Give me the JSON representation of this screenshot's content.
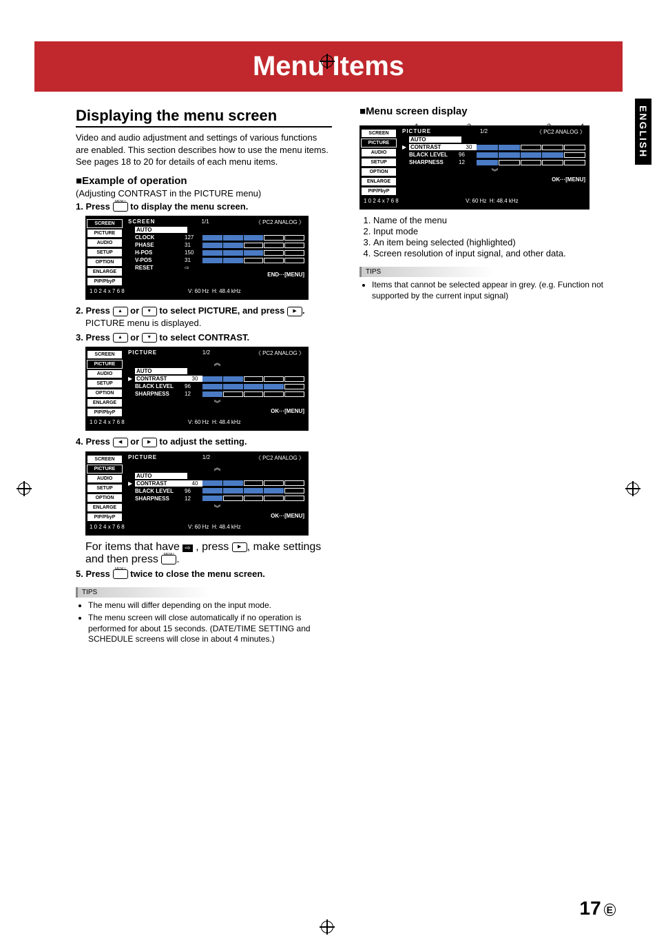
{
  "banner": "Menu Items",
  "lang_tab": "ENGLISH",
  "page_number": "17",
  "page_letter": "E",
  "left": {
    "h2": "Displaying the menu screen",
    "intro": "Video and audio adjustment and settings of various functions are enabled. This section describes how to use the menu items. See pages 18 to 20 for details of each menu items.",
    "h3": "Example of operation",
    "h3_sub": "(Adjusting CONTRAST in the PICTURE menu)",
    "steps": {
      "s1": "Press        to display the menu screen.",
      "s2": "Press        or        to select PICTURE, and press       .",
      "s2_after": "PICTURE menu is displayed.",
      "s3": "Press        or        to select CONTRAST.",
      "s4": "Press        or        to adjust the setting.",
      "s4_after1": "For items that have      , press       , make settings and then press       .",
      "s5": "Press        twice to close the menu screen."
    },
    "tips_label": "TIPS",
    "tips": [
      "The menu will differ depending on the input mode.",
      "The menu screen will close automatically if no operation is performed for about 15 seconds. (DATE/TIME SETTING and SCHEDULE screens will close in about 4 minutes.)"
    ]
  },
  "right": {
    "h3": "Menu screen display",
    "legend": [
      "Name of the menu",
      "Input mode",
      "An item being selected (highlighted)",
      "Screen resolution of input signal, and other data."
    ],
    "tips_label": "TIPS",
    "tips": [
      "Items that cannot be selected appear in grey. (e.g. Function not supported by the current input signal)"
    ]
  },
  "osd": {
    "tabs": [
      "SCREEN",
      "PICTURE",
      "AUDIO",
      "SETUP",
      "OPTION",
      "ENLARGE",
      "PIP/PbyP"
    ],
    "screen1": {
      "title": "SCREEN",
      "page": "1/1",
      "input": "〈 PC2 ANALOG 〉",
      "rows": [
        {
          "n": "AUTO",
          "hl": true
        },
        {
          "n": "CLOCK",
          "v": "127",
          "bar": 3
        },
        {
          "n": "PHASE",
          "v": "31",
          "bar": 2
        },
        {
          "n": "H-POS",
          "v": "150",
          "bar": 3
        },
        {
          "n": "V-POS",
          "v": "31",
          "bar": 2
        },
        {
          "n": "RESET",
          "v": "⇨"
        }
      ],
      "end": "END···[MENU]"
    },
    "screen2": {
      "title": "PICTURE",
      "page": "1/2",
      "input": "〈 PC2 ANALOG 〉",
      "rows": [
        {
          "n": "AUTO",
          "hl": true
        },
        {
          "n": "CONTRAST",
          "sel": true,
          "v": "30",
          "box": true,
          "bar": 2
        },
        {
          "n": "BLACK LEVEL",
          "v": "96",
          "bar": 4
        },
        {
          "n": "SHARPNESS",
          "v": "12",
          "bar": 1
        }
      ],
      "end": "OK···[MENU]"
    },
    "screen3": {
      "title": "PICTURE",
      "page": "1/2",
      "input": "〈 PC2 ANALOG 〉",
      "rows": [
        {
          "n": "AUTO",
          "hl": true
        },
        {
          "n": "CONTRAST",
          "sel": true,
          "v": "40",
          "box": true,
          "bar": 2
        },
        {
          "n": "BLACK LEVEL",
          "v": "96",
          "bar": 4
        },
        {
          "n": "SHARPNESS",
          "v": "12",
          "bar": 1
        }
      ],
      "end": "OK···[MENU]"
    },
    "resolution": "1 0 2 4 x 7 6 8",
    "vfreq": "V: 60 Hz",
    "hfreq": "H: 48.4 kHz"
  }
}
